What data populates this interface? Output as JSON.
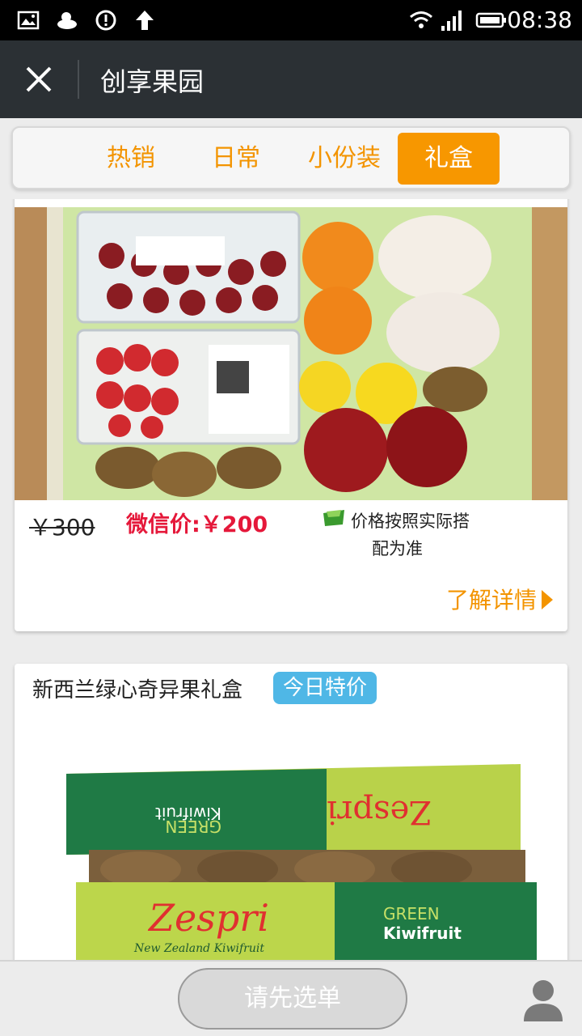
{
  "status_bar": {
    "time": "08:38",
    "icons": [
      "image-icon",
      "weather-cloud-icon",
      "sync-icon",
      "upload-arrow-icon",
      "wifi-icon",
      "signal-icon",
      "battery-icon"
    ]
  },
  "header": {
    "title": "创享果园",
    "close_icon": "close-icon"
  },
  "tabs": [
    {
      "label": "热销",
      "active": false
    },
    {
      "label": "日常",
      "active": false
    },
    {
      "label": "小份装",
      "active": false
    },
    {
      "label": "礼盒",
      "active": true
    }
  ],
  "products": [
    {
      "image": "fruit-gift-box-photo",
      "original_price": "￥300",
      "wechat_price": "微信价:￥200",
      "note_line1": "价格按照实际搭",
      "note_line2": "配为准",
      "details_link": "了解详情"
    },
    {
      "title": "新西兰绿心奇异果礼盒",
      "badge": "今日特价",
      "image": "kiwifruit-box-photo",
      "box_text_brand": "Zespri",
      "box_text_green": "GREEN",
      "box_text_kiwifruit": "Kiwifruit",
      "box_text_nz": "New Zealand Kiwifruit"
    }
  ],
  "bottom_bar": {
    "order_button": "请先选单",
    "user_icon": "user-icon"
  },
  "colors": {
    "accent": "#f79700",
    "price_red": "#e5183a",
    "badge_blue": "#4fb7e6",
    "header_bg": "#2b3034"
  }
}
